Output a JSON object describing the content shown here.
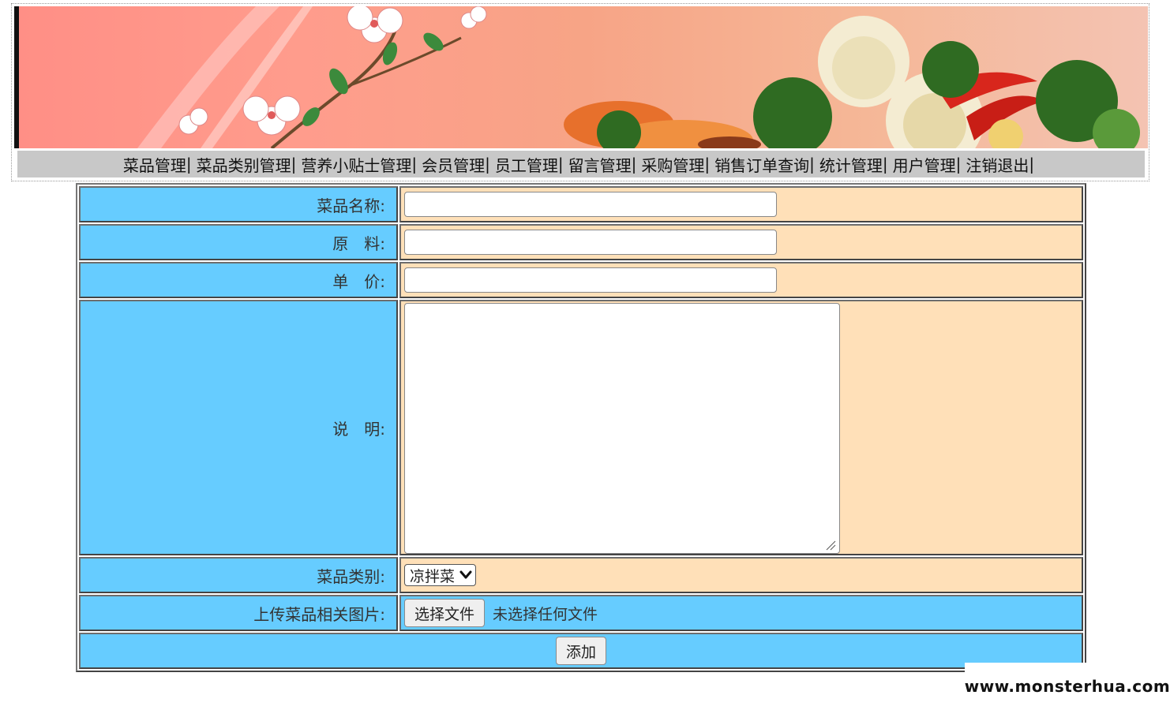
{
  "nav": {
    "items": [
      {
        "label": "菜品管理"
      },
      {
        "label": "菜品类别管理"
      },
      {
        "label": "营养小贴士管理"
      },
      {
        "label": "会员管理"
      },
      {
        "label": "员工管理"
      },
      {
        "label": "留言管理"
      },
      {
        "label": "采购管理"
      },
      {
        "label": "销售订单查询"
      },
      {
        "label": "统计管理"
      },
      {
        "label": "用户管理"
      },
      {
        "label": "注销退出"
      }
    ],
    "separator": "|"
  },
  "form": {
    "name_label": "菜品名称:",
    "name_value": "",
    "material_label": "原　料:",
    "material_value": "",
    "price_label": "单　价:",
    "price_value": "",
    "desc_label": "说　明:",
    "desc_value": "",
    "category_label": "菜品类别:",
    "category_value": "凉拌菜",
    "image_label": "上传菜品相关图片:",
    "file_button": "选择文件",
    "file_status": "未选择任何文件",
    "submit_label": "添加"
  },
  "watermark": "www.monsterhua.com",
  "colors": {
    "label_bg": "#66ccff",
    "value_bg": "#ffe0b8",
    "nav_bg": "#c8c8c8"
  }
}
